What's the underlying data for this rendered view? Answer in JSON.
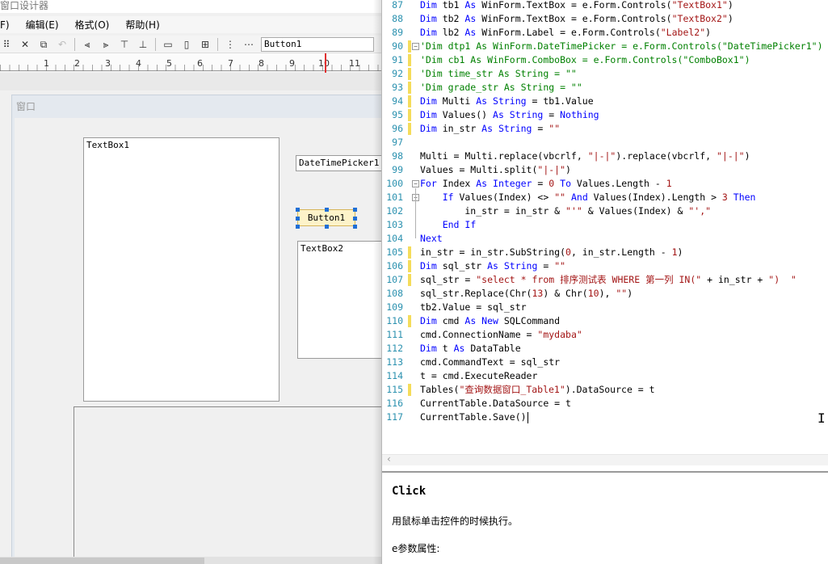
{
  "designer": {
    "title": "窗口设计器",
    "menu": [
      "F)",
      "编辑(E)",
      "格式(O)",
      "帮助(H)"
    ],
    "toolbar_combo_value": "Button1",
    "ruler_numbers": [
      "1",
      "2",
      "3",
      "4",
      "5",
      "6",
      "7",
      "8",
      "9",
      "10",
      "11"
    ],
    "window_title": "窗口",
    "controls": {
      "textbox1": "TextBox1",
      "dtp1": "DateTimePicker1",
      "button1": "Button1",
      "textbox2": "TextBox2"
    }
  },
  "editor": {
    "lines": [
      {
        "n": "87",
        "parts": [
          [
            "k",
            "Dim "
          ],
          [
            "",
            "tb1 "
          ],
          [
            "k",
            "As "
          ],
          [
            "",
            "WinForm.TextBox = e.Form.Controls("
          ],
          [
            "s",
            "\"TextBox1\""
          ],
          [
            "",
            ")"
          ]
        ],
        "bar": false
      },
      {
        "n": "88",
        "parts": [
          [
            "k",
            "Dim "
          ],
          [
            "",
            "tb2 "
          ],
          [
            "k",
            "As "
          ],
          [
            "",
            "WinForm.TextBox = e.Form.Controls("
          ],
          [
            "s",
            "\"TextBox2\""
          ],
          [
            "",
            ")"
          ]
        ],
        "bar": false
      },
      {
        "n": "89",
        "parts": [
          [
            "k",
            "Dim "
          ],
          [
            "",
            "lb2 "
          ],
          [
            "k",
            "As "
          ],
          [
            "",
            "WinForm.Label = e.Form.Controls("
          ],
          [
            "s",
            "\"Label2\""
          ],
          [
            "",
            ")"
          ]
        ],
        "bar": false
      },
      {
        "n": "90",
        "parts": [
          [
            "c",
            "'Dim dtp1 As WinForm.DateTimePicker = e.Form.Controls(\"DateTimePicker1\")"
          ]
        ],
        "bar": true,
        "fold": true
      },
      {
        "n": "91",
        "parts": [
          [
            "c",
            "'Dim cb1 As WinForm.ComboBox = e.Form.Controls(\"ComboBox1\")"
          ]
        ],
        "bar": true
      },
      {
        "n": "92",
        "parts": [
          [
            "c",
            "'Dim time_str As String = \"\""
          ]
        ],
        "bar": true
      },
      {
        "n": "93",
        "parts": [
          [
            "c",
            "'Dim grade_str As String = \"\""
          ]
        ],
        "bar": true
      },
      {
        "n": "94",
        "parts": [
          [
            "k",
            "Dim "
          ],
          [
            "",
            "Multi "
          ],
          [
            "k",
            "As String "
          ],
          [
            "",
            "= tb1.Value"
          ]
        ],
        "bar": true
      },
      {
        "n": "95",
        "parts": [
          [
            "k",
            "Dim "
          ],
          [
            "",
            "Values() "
          ],
          [
            "k",
            "As String "
          ],
          [
            "",
            "= "
          ],
          [
            "k",
            "Nothing"
          ]
        ],
        "bar": true
      },
      {
        "n": "96",
        "parts": [
          [
            "k",
            "Dim "
          ],
          [
            "",
            "in_str "
          ],
          [
            "k",
            "As String "
          ],
          [
            "",
            "= "
          ],
          [
            "s",
            "\"\""
          ]
        ],
        "bar": true
      },
      {
        "n": "97",
        "parts": [],
        "bar": false
      },
      {
        "n": "98",
        "parts": [
          [
            "",
            "Multi = Multi.replace(vbcrlf, "
          ],
          [
            "s",
            "\"|-|\""
          ],
          [
            "",
            ").replace(vbcrlf, "
          ],
          [
            "s",
            "\"|-|\""
          ],
          [
            "",
            ")"
          ]
        ],
        "bar": false
      },
      {
        "n": "99",
        "parts": [
          [
            "",
            "Values = Multi.split("
          ],
          [
            "s",
            "\"|-|\""
          ],
          [
            "",
            ")"
          ]
        ],
        "bar": false
      },
      {
        "n": "100",
        "parts": [
          [
            "k",
            "For "
          ],
          [
            "",
            "Index "
          ],
          [
            "k",
            "As Integer "
          ],
          [
            "",
            "= "
          ],
          [
            "s",
            "0 "
          ],
          [
            "k",
            "To "
          ],
          [
            "",
            "Values.Length - "
          ],
          [
            "s",
            "1"
          ]
        ],
        "bar": false,
        "fold": true
      },
      {
        "n": "101",
        "parts": [
          [
            "",
            "    "
          ],
          [
            "k",
            "If "
          ],
          [
            "",
            "Values(Index) <> "
          ],
          [
            "s",
            "\"\" "
          ],
          [
            "k",
            "And "
          ],
          [
            "",
            "Values(Index).Length > "
          ],
          [
            "s",
            "3 "
          ],
          [
            "k",
            "Then"
          ]
        ],
        "bar": false,
        "fold": true
      },
      {
        "n": "102",
        "parts": [
          [
            "",
            "        in_str = in_str & "
          ],
          [
            "s",
            "\"'\" "
          ],
          [
            "",
            "& Values(Index) & "
          ],
          [
            "s",
            "\"',\""
          ]
        ],
        "bar": false
      },
      {
        "n": "103",
        "parts": [
          [
            "",
            "    "
          ],
          [
            "k",
            "End If"
          ]
        ],
        "bar": false
      },
      {
        "n": "104",
        "parts": [
          [
            "k",
            "Next"
          ]
        ],
        "bar": false
      },
      {
        "n": "105",
        "parts": [
          [
            "",
            "in_str = in_str.SubString("
          ],
          [
            "s",
            "0"
          ],
          [
            ",",
            " in_str.Length - "
          ],
          [
            "s",
            "1"
          ],
          [
            "",
            ")"
          ]
        ],
        "bar": true
      },
      {
        "n": "106",
        "parts": [
          [
            "k",
            "Dim "
          ],
          [
            "",
            "sql_str "
          ],
          [
            "k",
            "As String "
          ],
          [
            "",
            "= "
          ],
          [
            "s",
            "\"\""
          ]
        ],
        "bar": true
      },
      {
        "n": "107",
        "parts": [
          [
            "",
            "sql_str = "
          ],
          [
            "s",
            "\"select * from 排序测试表 WHERE 第一列 IN(\" "
          ],
          [
            "",
            "+ in_str + "
          ],
          [
            "s",
            "\")  \""
          ]
        ],
        "bar": true
      },
      {
        "n": "108",
        "parts": [
          [
            "",
            "sql_str.Replace(Chr("
          ],
          [
            "s",
            "13"
          ],
          [
            "",
            ") & Chr("
          ],
          [
            "s",
            "10"
          ],
          [
            "",
            "), "
          ],
          [
            "s",
            "\"\""
          ],
          [
            "",
            ")"
          ]
        ],
        "bar": false
      },
      {
        "n": "109",
        "parts": [
          [
            "",
            "tb2.Value = sql_str"
          ]
        ],
        "bar": false
      },
      {
        "n": "110",
        "parts": [
          [
            "k",
            "Dim "
          ],
          [
            "",
            "cmd "
          ],
          [
            "k",
            "As New "
          ],
          [
            "",
            "SQLCommand"
          ]
        ],
        "bar": true
      },
      {
        "n": "111",
        "parts": [
          [
            "",
            "cmd.ConnectionName = "
          ],
          [
            "s",
            "\"mydaba\""
          ]
        ],
        "bar": false
      },
      {
        "n": "112",
        "parts": [
          [
            "k",
            "Dim "
          ],
          [
            "",
            "t "
          ],
          [
            "k",
            "As "
          ],
          [
            "",
            "DataTable"
          ]
        ],
        "bar": false
      },
      {
        "n": "113",
        "parts": [
          [
            "",
            "cmd.CommandText = sql_str"
          ]
        ],
        "bar": false
      },
      {
        "n": "114",
        "parts": [
          [
            "",
            "t = cmd.ExecuteReader"
          ]
        ],
        "bar": false
      },
      {
        "n": "115",
        "parts": [
          [
            "",
            "Tables("
          ],
          [
            "s",
            "\"查询数据窗口_Table1\""
          ],
          [
            "",
            ").DataSource = t"
          ]
        ],
        "bar": true
      },
      {
        "n": "116",
        "parts": [
          [
            "",
            "CurrentTable.DataSource = t"
          ]
        ],
        "bar": false
      },
      {
        "n": "117",
        "parts": [
          [
            "",
            "CurrentTable.Save()"
          ]
        ],
        "bar": false
      }
    ]
  },
  "help": {
    "title": "Click",
    "description": "用鼠标单击控件的时候执行。",
    "e_props": "e参数属性:"
  }
}
